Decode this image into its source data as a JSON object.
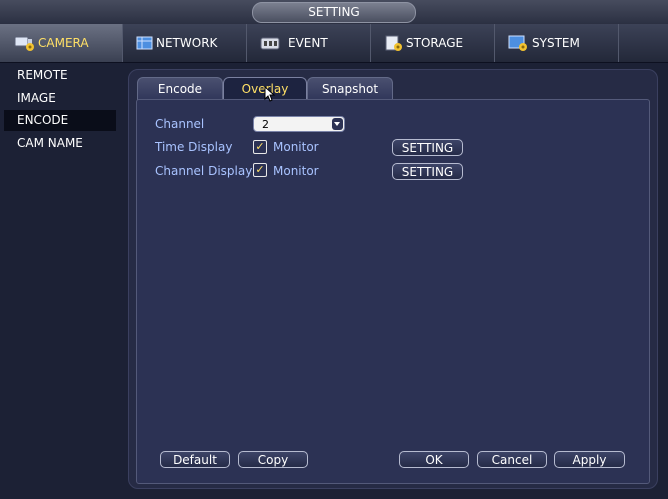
{
  "window": {
    "title": "SETTING"
  },
  "main_tabs": [
    {
      "label": "CAMERA",
      "icon": "camera-icon",
      "active": true
    },
    {
      "label": "NETWORK",
      "icon": "network-icon",
      "active": false
    },
    {
      "label": "EVENT",
      "icon": "event-icon",
      "active": false
    },
    {
      "label": "STORAGE",
      "icon": "storage-icon",
      "active": false
    },
    {
      "label": "SYSTEM",
      "icon": "system-icon",
      "active": false
    }
  ],
  "sidebar": {
    "items": [
      {
        "label": "REMOTE",
        "active": false
      },
      {
        "label": "IMAGE",
        "active": false
      },
      {
        "label": "ENCODE",
        "active": true
      },
      {
        "label": "CAM NAME",
        "active": false
      }
    ]
  },
  "sub_tabs": [
    {
      "label": "Encode",
      "active": false
    },
    {
      "label": "Overlay",
      "active": true
    },
    {
      "label": "Snapshot",
      "active": false
    }
  ],
  "form": {
    "channel_label": "Channel",
    "channel_value": "2",
    "time_display_label": "Time Display",
    "time_display_checkbox_label": "Monitor",
    "time_display_checked": true,
    "time_display_setting": "SETTING",
    "channel_display_label": "Channel Display",
    "channel_display_checkbox_label": "Monitor",
    "channel_display_checked": true,
    "channel_display_setting": "SETTING"
  },
  "footer": {
    "default_label": "Default",
    "copy_label": "Copy",
    "ok_label": "OK",
    "cancel_label": "Cancel",
    "apply_label": "Apply"
  },
  "colors": {
    "accent_active_text": "#ffe066",
    "label_text": "#a9c3ff",
    "background": "#1c2135",
    "panel": "#2c3254"
  }
}
